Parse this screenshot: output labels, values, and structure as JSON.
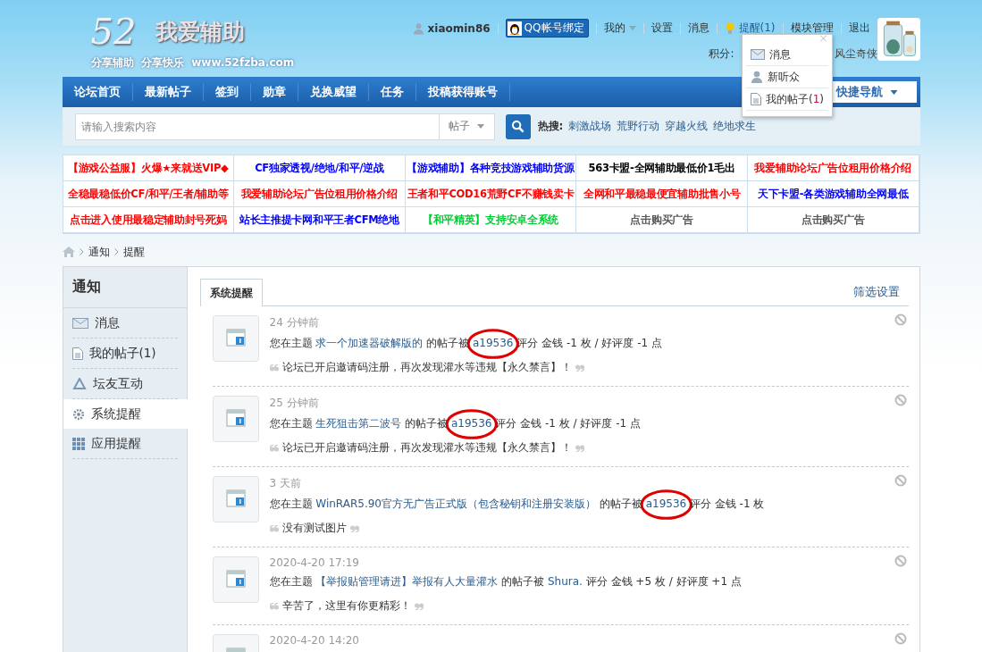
{
  "logo": {
    "number": "52",
    "name": "我爱辅助",
    "slogan": "分享辅助  分享快乐  www.52fzba.com"
  },
  "user_bar": {
    "username": "xiaomin86",
    "qq_button": "QQ帐号绑定",
    "links": [
      {
        "label": "我的",
        "dropdown": true
      },
      {
        "label": "设置",
        "dropdown": false
      },
      {
        "label": "消息",
        "dropdown": false
      },
      {
        "label": "提醒(1)",
        "dropdown": false,
        "kind": "bulb"
      },
      {
        "label": "模块管理",
        "dropdown": false
      },
      {
        "label": "退出",
        "dropdown": false
      }
    ],
    "points_label": "积分:",
    "group": "风尘奇侠"
  },
  "avatar": {
    "kind": "picture"
  },
  "popup": {
    "close": "×",
    "items": [
      {
        "label": "消息",
        "kind": "mail"
      },
      {
        "label": "新听众",
        "kind": "person"
      },
      {
        "label": "我的帖子(",
        "count": "1",
        "tail": ")",
        "kind": "doc"
      }
    ]
  },
  "nav": {
    "items": [
      "论坛首页",
      "最新帖子",
      "签到",
      "勋章",
      "兑换威望",
      "任务",
      "投稿获得账号"
    ],
    "quick_nav": "快捷导航"
  },
  "search": {
    "placeholder": "请输入搜索内容",
    "scope": "帖子",
    "hot_label": "热搜:",
    "hot": [
      "刺激战场",
      "荒野行动",
      "穿越火线",
      "绝地求生"
    ]
  },
  "ads": [
    [
      {
        "text": "【游戏公益服】火爆★来就送VIP◆",
        "color": "#ff0000"
      },
      {
        "text": "CF独家透视/绝地/和平/逆战",
        "color": "#0000ff"
      },
      {
        "text": "【游戏辅助】各种竞技游戏辅助货源",
        "color": "#0000ff"
      },
      {
        "text": "563卡盟-全网辅助最低价1毛出",
        "color": "#000000"
      },
      {
        "text": "我爱辅助论坛广告位租用价格介绍",
        "color": "#ff0000"
      }
    ],
    [
      {
        "text": "全稳最稳低价CF/和平/王者/辅助等",
        "color": "#ff0000"
      },
      {
        "text": "我爱辅助论坛广告位租用价格介绍",
        "color": "#ff0000"
      },
      {
        "text": "王者和平COD16荒野CF不赚钱卖卡",
        "color": "#ff0000"
      },
      {
        "text": "全网和平最稳最便宜辅助批售小号",
        "color": "#ff0000"
      },
      {
        "text": "天下卡盟-各类游戏辅助全网最低",
        "color": "#0000ff"
      }
    ],
    [
      {
        "text": "点击进入使用最稳定辅助封号死妈",
        "color": "#ff0000"
      },
      {
        "text": "站长主推提卡网和平王者CFM绝地",
        "color": "#0000ff"
      },
      {
        "text": "【和平精英】支持安卓全系统",
        "color": "#00cc33"
      },
      {
        "text": "点击购买广告",
        "color": "#555555"
      },
      {
        "text": "点击购买广告",
        "color": "#555555"
      }
    ]
  ],
  "breadcrumb": [
    "通知",
    "提醒"
  ],
  "sidebar": {
    "title": "通知",
    "items": [
      {
        "label": "消息",
        "kind": "mail",
        "selected": false
      },
      {
        "label": "我的帖子(1)",
        "kind": "doc",
        "selected": false
      },
      {
        "label": "坛友互动",
        "kind": "recycle",
        "selected": false
      },
      {
        "label": "系统提醒",
        "kind": "gear",
        "selected": true
      },
      {
        "label": "应用提醒",
        "kind": "grid",
        "selected": false
      }
    ]
  },
  "tabs": [
    {
      "label": "系统提醒",
      "selected": true
    }
  ],
  "filter_link": "筛选设置",
  "notices": [
    {
      "time": "24 分钟前",
      "prefix": "您在主题",
      "topic": "求一个加速器破解版的",
      "middle": "的帖子被",
      "user": "a19536",
      "rest": "评分 金钱 -1 枚 / 好评度 -1 点",
      "quote": "论坛已开启邀请码注册，再次发现灌水等违规【永久禁言】！",
      "circled": true
    },
    {
      "time": "25 分钟前",
      "prefix": "您在主题",
      "topic": "生死狙击第二波号",
      "middle": "的帖子被",
      "user": "a19536",
      "rest": "评分 金钱 -1 枚 / 好评度 -1 点",
      "quote": "论坛已开启邀请码注册，再次发现灌水等违规【永久禁言】！",
      "circled": true
    },
    {
      "time": "3 天前",
      "prefix": "您在主题",
      "topic": "WinRAR5.90官方无广告正式版（包含秘钥和注册安装版）",
      "middle": "的帖子被",
      "user": "a19536",
      "rest": "评分 金钱 -1 枚",
      "quote": "没有测试图片",
      "circled": true
    },
    {
      "time": "2020-4-20 17:19",
      "prefix": "您在主题",
      "topic": "【举报贴管理请进】举报有人大量灌水",
      "middle": "的帖子被",
      "user": "Shura.",
      "rest": "评分 金钱 +5 枚 / 好评度 +1 点",
      "quote": "辛苦了，这里有你更精彩！",
      "circled": false
    },
    {
      "time": "2020-4-20 14:20"
    }
  ]
}
